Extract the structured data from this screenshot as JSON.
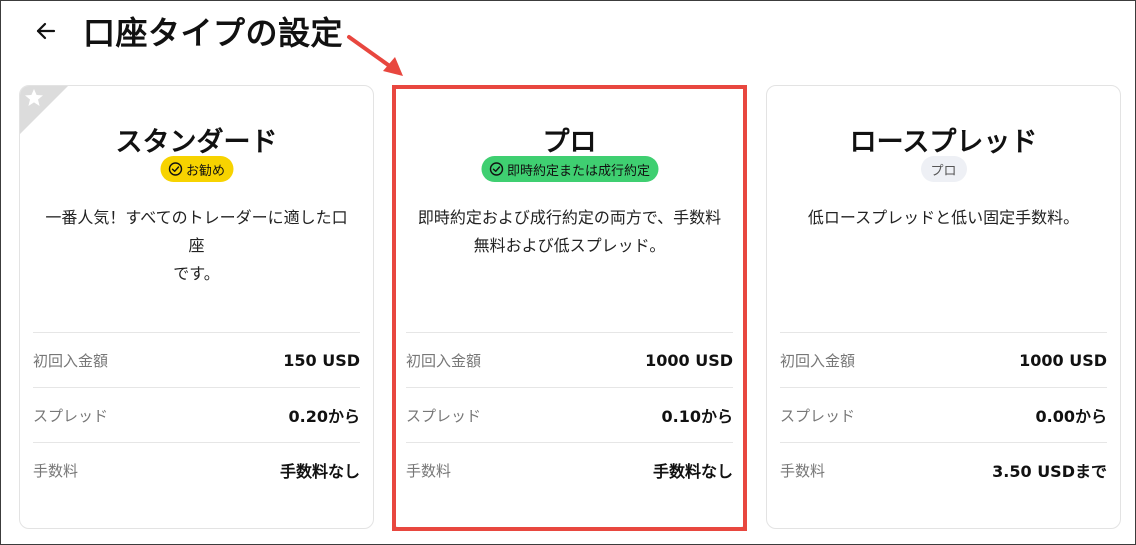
{
  "header": {
    "title": "口座タイプの設定"
  },
  "colors": {
    "annotation_red": "#e8473f",
    "badge_yellow": "#f7d300",
    "badge_green": "#3fcf71",
    "badge_gray": "#eef0f5"
  },
  "cards": [
    {
      "title": "スタンダード",
      "badge": "お勧め",
      "badge_icon": "check-circle-icon",
      "corner_icon": "star-icon",
      "description_lines": [
        "一番人気！すべてのトレーダーに適した口座",
        "です。"
      ],
      "rows": [
        {
          "label": "初回入金額",
          "value": "150 USD"
        },
        {
          "label": "スプレッド",
          "value": "0.20から"
        },
        {
          "label": "手数料",
          "value": "手数料なし"
        }
      ]
    },
    {
      "title": "プロ",
      "badge": "即時約定または成行約定",
      "badge_icon": "check-circle-icon",
      "description_lines": [
        "即時約定および成行約定の両方で、手数料",
        "無料および低スプレッド。"
      ],
      "rows": [
        {
          "label": "初回入金額",
          "value": "1000 USD"
        },
        {
          "label": "スプレッド",
          "value": "0.10から"
        },
        {
          "label": "手数料",
          "value": "手数料なし"
        }
      ]
    },
    {
      "title": "ロースプレッド",
      "badge": "プロ",
      "description_lines": [
        "低ロースプレッドと低い固定手数料。",
        ""
      ],
      "rows": [
        {
          "label": "初回入金額",
          "value": "1000 USD"
        },
        {
          "label": "スプレッド",
          "value": "0.00から"
        },
        {
          "label": "手数料",
          "value": "3.50 USDまで"
        }
      ]
    }
  ]
}
